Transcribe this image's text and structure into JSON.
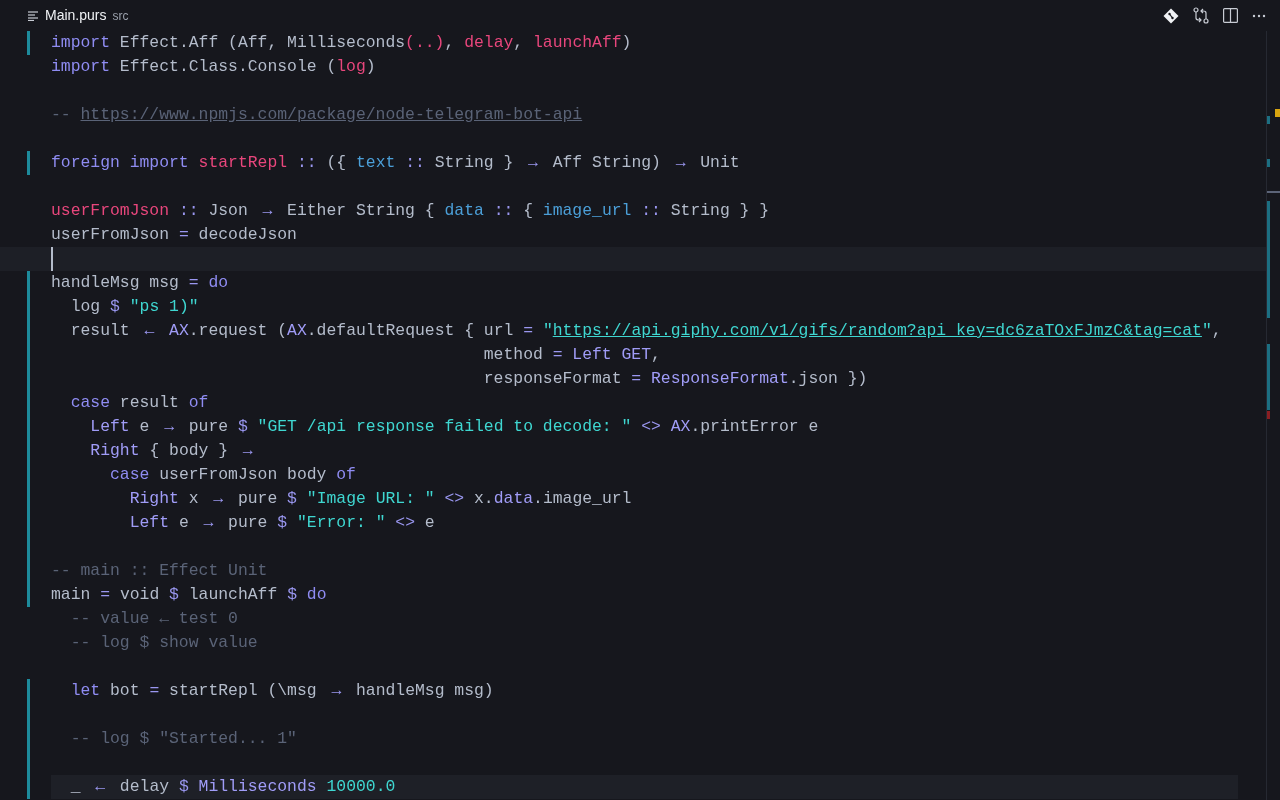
{
  "tab": {
    "file": "Main.purs",
    "folder": "src"
  },
  "lines": [
    {
      "modified": true,
      "cursor": false,
      "highlighted": false,
      "tokens": [
        {
          "kind": "kw",
          "text": "import "
        },
        {
          "kind": "p",
          "text": "Effect.Aff (Aff, Milliseconds"
        },
        {
          "kind": "fn",
          "text": "(..)"
        },
        {
          "kind": "p",
          "text": ", "
        },
        {
          "kind": "fn",
          "text": "delay"
        },
        {
          "kind": "p",
          "text": ", "
        },
        {
          "kind": "fn",
          "text": "launchAff"
        },
        {
          "kind": "p",
          "text": ")"
        }
      ]
    },
    {
      "modified": false,
      "cursor": false,
      "highlighted": false,
      "tokens": [
        {
          "kind": "kw",
          "text": "import "
        },
        {
          "kind": "p",
          "text": "Effect.Class.Console ("
        },
        {
          "kind": "fn",
          "text": "log"
        },
        {
          "kind": "p",
          "text": ")"
        }
      ]
    },
    {
      "modified": false,
      "cursor": false,
      "highlighted": false
    },
    {
      "modified": false,
      "cursor": false,
      "highlighted": false,
      "tokens": [
        {
          "kind": "com",
          "text": "-- "
        },
        {
          "kind": "link",
          "text": "https://www.npmjs.com/package/node-telegram-bot-api"
        }
      ]
    },
    {
      "modified": false,
      "cursor": false,
      "highlighted": false
    },
    {
      "modified": true,
      "cursor": false,
      "highlighted": false,
      "tokens": [
        {
          "kind": "kw",
          "text": "foreign import "
        },
        {
          "kind": "fn",
          "text": "startRepl "
        },
        {
          "kind": "op",
          "text": ":: "
        },
        {
          "kind": "p",
          "text": "({ "
        },
        {
          "kind": "field",
          "text": "text "
        },
        {
          "kind": "op",
          "text": ":: "
        },
        {
          "kind": "p",
          "text": "String } "
        },
        {
          "kind": "arrow",
          "text": "→"
        },
        {
          "kind": "p",
          "text": " Aff String) "
        },
        {
          "kind": "arrow",
          "text": "→"
        },
        {
          "kind": "p",
          "text": " Unit"
        }
      ]
    },
    {
      "modified": false,
      "cursor": false,
      "highlighted": false
    },
    {
      "modified": false,
      "cursor": false,
      "highlighted": false,
      "tokens": [
        {
          "kind": "fn",
          "text": "userFromJson "
        },
        {
          "kind": "op",
          "text": ":: "
        },
        {
          "kind": "p",
          "text": "Json "
        },
        {
          "kind": "arrow",
          "text": "→"
        },
        {
          "kind": "p",
          "text": " Either String { "
        },
        {
          "kind": "field",
          "text": "data "
        },
        {
          "kind": "op",
          "text": ":: "
        },
        {
          "kind": "p",
          "text": "{ "
        },
        {
          "kind": "field",
          "text": "image_url "
        },
        {
          "kind": "op",
          "text": ":: "
        },
        {
          "kind": "p",
          "text": "String } }"
        }
      ]
    },
    {
      "modified": false,
      "cursor": false,
      "highlighted": false,
      "tokens": [
        {
          "kind": "p",
          "text": "userFromJson "
        },
        {
          "kind": "op",
          "text": "= "
        },
        {
          "kind": "p",
          "text": "decodeJson"
        }
      ]
    },
    {
      "modified": false,
      "cursor": true,
      "highlighted": false
    },
    {
      "modified": true,
      "cursor": false,
      "highlighted": false,
      "tokens": [
        {
          "kind": "p",
          "text": "handleMsg msg "
        },
        {
          "kind": "op",
          "text": "= "
        },
        {
          "kind": "kw",
          "text": "do"
        }
      ]
    },
    {
      "modified": true,
      "cursor": false,
      "highlighted": false,
      "tokens": [
        {
          "kind": "p",
          "text": "  log "
        },
        {
          "kind": "op",
          "text": "$ "
        },
        {
          "kind": "str",
          "text": "\"ps 1)\""
        }
      ]
    },
    {
      "modified": true,
      "cursor": false,
      "highlighted": false,
      "tokens": [
        {
          "kind": "p",
          "text": "  result "
        },
        {
          "kind": "arrow",
          "text": "←"
        },
        {
          "kind": "ty",
          "text": " AX"
        },
        {
          "kind": "p",
          "text": ".request ("
        },
        {
          "kind": "ty",
          "text": "AX"
        },
        {
          "kind": "p",
          "text": ".defaultRequest { url "
        },
        {
          "kind": "op",
          "text": "= "
        },
        {
          "kind": "str",
          "text": "\""
        },
        {
          "kind": "slink",
          "text": "https://api.giphy.com/v1/gifs/random?api_key=dc6zaTOxFJmzC&tag=cat"
        },
        {
          "kind": "str",
          "text": "\""
        },
        {
          "kind": "p",
          "text": ","
        }
      ]
    },
    {
      "modified": true,
      "cursor": false,
      "highlighted": false,
      "tokens": [
        {
          "kind": "p",
          "text": "                                            method "
        },
        {
          "kind": "op",
          "text": "= "
        },
        {
          "kind": "ty",
          "text": "Left GET"
        },
        {
          "kind": "p",
          "text": ","
        }
      ]
    },
    {
      "modified": true,
      "cursor": false,
      "highlighted": false,
      "tokens": [
        {
          "kind": "p",
          "text": "                                            responseFormat "
        },
        {
          "kind": "op",
          "text": "= "
        },
        {
          "kind": "ty",
          "text": "ResponseFormat"
        },
        {
          "kind": "p",
          "text": ".json })"
        }
      ]
    },
    {
      "modified": true,
      "cursor": false,
      "highlighted": false,
      "tokens": [
        {
          "kind": "kw",
          "text": "  case "
        },
        {
          "kind": "p",
          "text": "result "
        },
        {
          "kind": "kw",
          "text": "of"
        }
      ]
    },
    {
      "modified": true,
      "cursor": false,
      "highlighted": false,
      "tokens": [
        {
          "kind": "ty",
          "text": "    Left "
        },
        {
          "kind": "p",
          "text": "e "
        },
        {
          "kind": "arrow",
          "text": "→"
        },
        {
          "kind": "p",
          "text": " pure "
        },
        {
          "kind": "op",
          "text": "$ "
        },
        {
          "kind": "str",
          "text": "\"GET /api response failed to decode: \""
        },
        {
          "kind": "op",
          "text": " <> "
        },
        {
          "kind": "ty",
          "text": "AX"
        },
        {
          "kind": "p",
          "text": ".printError e"
        }
      ]
    },
    {
      "modified": true,
      "cursor": false,
      "highlighted": false,
      "tokens": [
        {
          "kind": "ty",
          "text": "    Right "
        },
        {
          "kind": "p",
          "text": "{ body } "
        },
        {
          "kind": "arrow",
          "text": "→"
        }
      ]
    },
    {
      "modified": true,
      "cursor": false,
      "highlighted": false,
      "tokens": [
        {
          "kind": "kw",
          "text": "      case "
        },
        {
          "kind": "p",
          "text": "userFromJson body "
        },
        {
          "kind": "kw",
          "text": "of"
        }
      ]
    },
    {
      "modified": true,
      "cursor": false,
      "highlighted": false,
      "tokens": [
        {
          "kind": "ty",
          "text": "        Right "
        },
        {
          "kind": "p",
          "text": "x "
        },
        {
          "kind": "arrow",
          "text": "→"
        },
        {
          "kind": "p",
          "text": " pure "
        },
        {
          "kind": "op",
          "text": "$ "
        },
        {
          "kind": "str",
          "text": "\"Image URL: \""
        },
        {
          "kind": "op",
          "text": " <> "
        },
        {
          "kind": "p",
          "text": "x."
        },
        {
          "kind": "ty",
          "text": "data"
        },
        {
          "kind": "p",
          "text": ".image_url"
        }
      ]
    },
    {
      "modified": true,
      "cursor": false,
      "highlighted": false,
      "tokens": [
        {
          "kind": "ty",
          "text": "        Left "
        },
        {
          "kind": "p",
          "text": "e "
        },
        {
          "kind": "arrow",
          "text": "→"
        },
        {
          "kind": "p",
          "text": " pure "
        },
        {
          "kind": "op",
          "text": "$ "
        },
        {
          "kind": "str",
          "text": "\"Error: \""
        },
        {
          "kind": "op",
          "text": " <> "
        },
        {
          "kind": "p",
          "text": "e"
        }
      ]
    },
    {
      "modified": true,
      "cursor": false,
      "highlighted": false
    },
    {
      "modified": true,
      "cursor": false,
      "highlighted": false,
      "tokens": [
        {
          "kind": "com",
          "text": "-- main :: Effect Unit"
        }
      ]
    },
    {
      "modified": true,
      "cursor": false,
      "highlighted": false,
      "tokens": [
        {
          "kind": "p",
          "text": "main "
        },
        {
          "kind": "op",
          "text": "= "
        },
        {
          "kind": "p",
          "text": "void "
        },
        {
          "kind": "op",
          "text": "$ "
        },
        {
          "kind": "p",
          "text": "launchAff "
        },
        {
          "kind": "op",
          "text": "$ "
        },
        {
          "kind": "kw",
          "text": "do"
        }
      ]
    },
    {
      "modified": false,
      "cursor": false,
      "highlighted": false,
      "tokens": [
        {
          "kind": "com",
          "text": "  -- value ← test 0"
        }
      ]
    },
    {
      "modified": false,
      "cursor": false,
      "highlighted": false,
      "tokens": [
        {
          "kind": "com",
          "text": "  -- log $ show value"
        }
      ]
    },
    {
      "modified": false,
      "cursor": false,
      "highlighted": false
    },
    {
      "modified": true,
      "cursor": false,
      "highlighted": false,
      "tokens": [
        {
          "kind": "kw",
          "text": "  let "
        },
        {
          "kind": "p",
          "text": "bot "
        },
        {
          "kind": "op",
          "text": "= "
        },
        {
          "kind": "p",
          "text": "startRepl (\\msg "
        },
        {
          "kind": "arrow",
          "text": "→"
        },
        {
          "kind": "p",
          "text": " handleMsg msg)"
        }
      ]
    },
    {
      "modified": true,
      "cursor": false,
      "highlighted": false
    },
    {
      "modified": true,
      "cursor": false,
      "highlighted": false,
      "tokens": [
        {
          "kind": "com",
          "text": "  -- log $ \"Started... 1\""
        }
      ]
    },
    {
      "modified": true,
      "cursor": false,
      "highlighted": false
    },
    {
      "modified": true,
      "cursor": false,
      "highlighted": true,
      "tokens": [
        {
          "kind": "p",
          "text": "  _ "
        },
        {
          "kind": "arrow",
          "text": "←"
        },
        {
          "kind": "p",
          "text": " delay "
        },
        {
          "kind": "op",
          "text": "$ "
        },
        {
          "kind": "ty",
          "text": "Milliseconds "
        },
        {
          "kind": "num",
          "text": "10000.0"
        }
      ]
    }
  ]
}
